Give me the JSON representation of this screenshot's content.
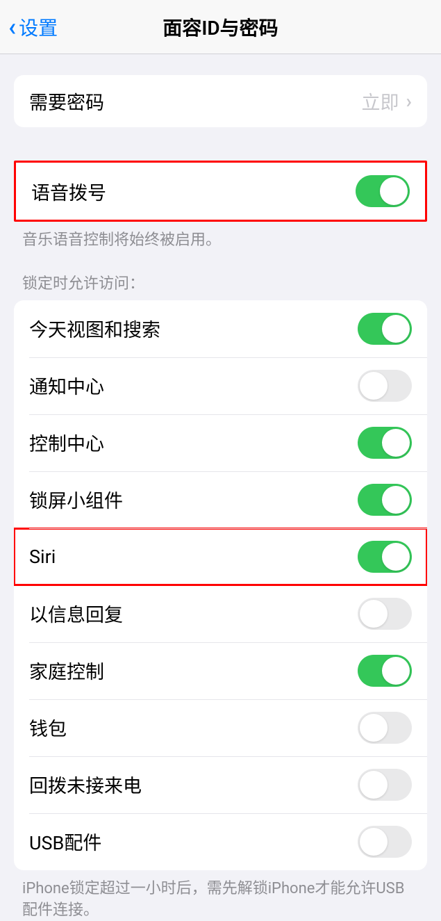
{
  "header": {
    "back_label": "设置",
    "title": "面容ID与密码"
  },
  "require_passcode": {
    "label": "需要密码",
    "value": "立即"
  },
  "voice_dial": {
    "label": "语音拨号",
    "enabled": true,
    "footer": "音乐语音控制将始终被启用。"
  },
  "allow_access_header": "锁定时允许访问：",
  "allow_access": [
    {
      "label": "今天视图和搜索",
      "enabled": true
    },
    {
      "label": "通知中心",
      "enabled": false
    },
    {
      "label": "控制中心",
      "enabled": true
    },
    {
      "label": "锁屏小组件",
      "enabled": true
    },
    {
      "label": "Siri",
      "enabled": true
    },
    {
      "label": "以信息回复",
      "enabled": false
    },
    {
      "label": "家庭控制",
      "enabled": true
    },
    {
      "label": "钱包",
      "enabled": false
    },
    {
      "label": "回拨未接来电",
      "enabled": false
    },
    {
      "label": "USB配件",
      "enabled": false
    }
  ],
  "usb_footer": "iPhone锁定超过一小时后，需先解锁iPhone才能允许USB配件连接。",
  "highlighted_rows": [
    0,
    4
  ]
}
